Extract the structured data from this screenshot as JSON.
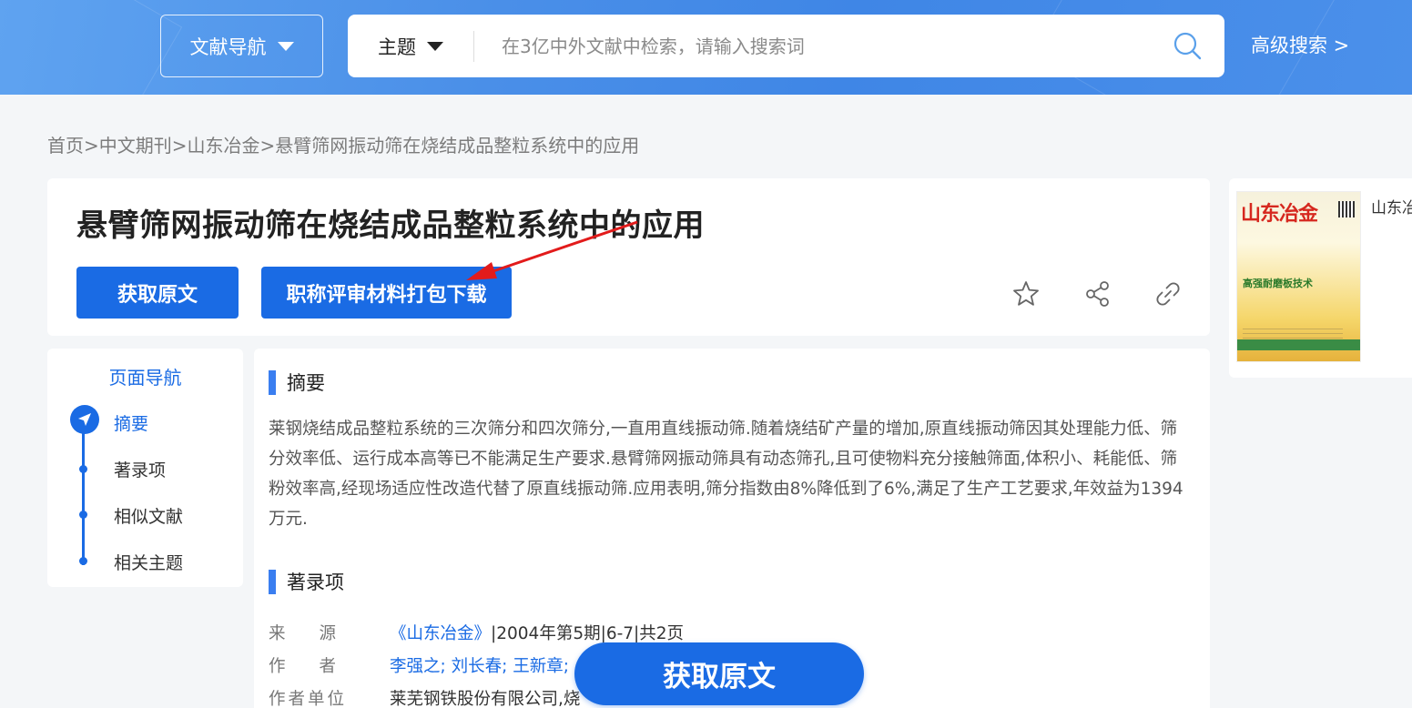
{
  "header": {
    "nav_label": "文献导航",
    "search_scope": "主题",
    "search_placeholder": "在3亿中外文献中检索，请输入搜索词",
    "advanced_search": "高级搜索 >"
  },
  "breadcrumb": [
    "首页>",
    " 中文期刊>",
    "山东冶金",
    " >悬臂筛网振动筛在烧结成品整粒系统中的应用"
  ],
  "article": {
    "title": "悬臂筛网振动筛在烧结成品整粒系统中的应用",
    "get_fulltext": "获取原文",
    "package_download": "职称评审材料打包下载"
  },
  "journal": {
    "name": "山东冶",
    "cover_title": "山东冶金",
    "cover_subtitle": "高强耐磨板技术"
  },
  "page_nav": {
    "title": "页面导航",
    "items": [
      "摘要",
      "著录项",
      "相似文献",
      "相关主题"
    ]
  },
  "abstract": {
    "heading": "摘要",
    "text": "莱钢烧结成品整粒系统的三次筛分和四次筛分,一直用直线振动筛.随着烧结矿产量的增加,原直线振动筛因其处理能力低、筛分效率低、运行成本高等已不能满足生产要求.悬臂筛网振动筛具有动态筛孔,且可使物料充分接触筛面,体积小、耗能低、筛粉效率高,经现场适应性改造代替了原直线振动筛.应用表明,筛分指数由8%降低到了6%,满足了生产工艺要求,年效益为1394万元."
  },
  "bibliography": {
    "heading": "著录项",
    "source_label": "来　　源",
    "source_journal": "《山东冶金》",
    "source_detail": "|2004年第5期|6-7|共2页",
    "author_label": "作　　者",
    "authors": "李强之; 刘长春; 王新章;",
    "affiliation_label": "作者单位",
    "affiliation": "莱芜钢铁股份有限公司,烧"
  },
  "floating_button": "获取原文",
  "colors": {
    "primary": "#1a6be4",
    "header": "#4a8fe8",
    "annotation": "#e21b1b"
  }
}
